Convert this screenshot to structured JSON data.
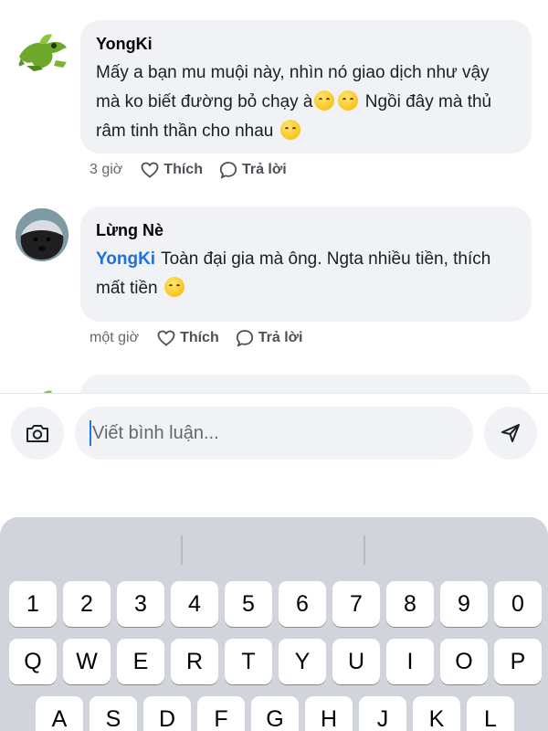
{
  "comments": [
    {
      "author": "YongKi",
      "text": "Mấy a bạn mu muội này, nhìn nó giao dịch như vậy mà ko biết đường bỏ chạy à",
      "text_after_emojis": " Ngồi đây mà thủ râm tinh thần cho nhau",
      "time": "3 giờ",
      "like_label": "Thích",
      "reply_label": "Trả lời"
    },
    {
      "author": "Lừng Nè",
      "mention": "YongKi",
      "text": "Toàn đại gia mà ông. Ngta nhiều tiền, thích mất tiền",
      "time": "một giờ",
      "like_label": "Thích",
      "reply_label": "Trả lời"
    }
  ],
  "composer": {
    "placeholder": "Viết bình luận...",
    "camera_icon": "camera-icon",
    "send_icon": "send-icon"
  },
  "keyboard": {
    "number_row": [
      "1",
      "2",
      "3",
      "4",
      "5",
      "6",
      "7",
      "8",
      "9",
      "0"
    ],
    "row1": [
      "Q",
      "W",
      "E",
      "R",
      "T",
      "Y",
      "U",
      "I",
      "O",
      "P"
    ],
    "row2": [
      "A",
      "S",
      "D",
      "F",
      "G",
      "H",
      "J",
      "K",
      "L"
    ]
  },
  "colors": {
    "mention": "#216fdb",
    "bubble": "#f0f2f5",
    "keyboard": "#d1d4db",
    "caret": "#1877f2"
  }
}
